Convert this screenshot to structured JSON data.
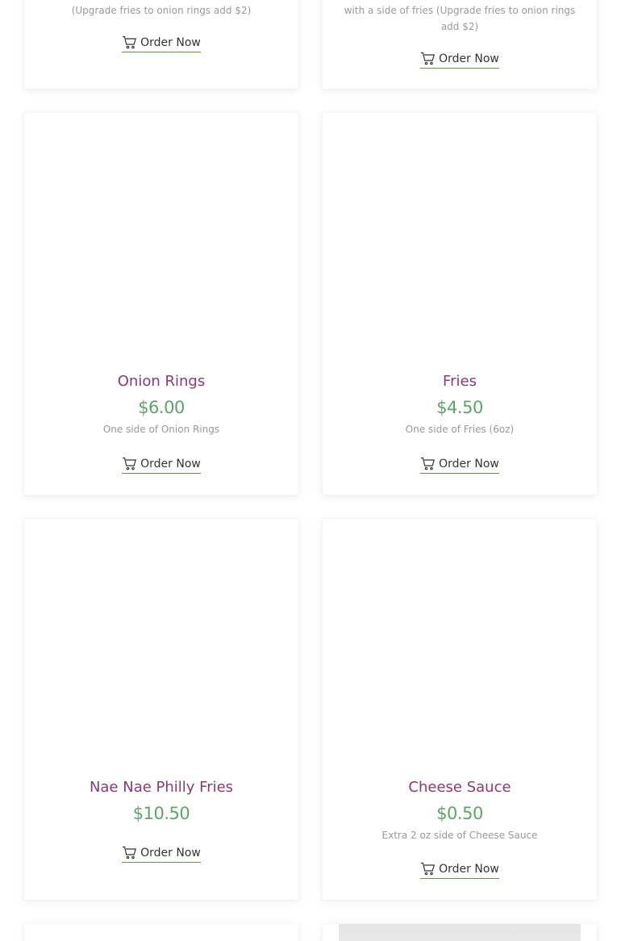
{
  "items": [
    {
      "name": "",
      "price": "",
      "description": "(Upgrade fries to onion rings add $2)",
      "order_label": "Order Now"
    },
    {
      "name": "",
      "price": "",
      "description": "with a side of fries (Upgrade fries to onion rings add $2)",
      "order_label": "Order Now"
    },
    {
      "name": "Onion Rings",
      "price": "$6.00",
      "description": "One side of Onion Rings",
      "order_label": "Order Now"
    },
    {
      "name": "Fries",
      "price": "$4.50",
      "description": "One side of Fries (6oz)",
      "order_label": "Order Now"
    },
    {
      "name": "Nae Nae Philly Fries",
      "price": "$10.50",
      "description": "",
      "order_label": "Order Now"
    },
    {
      "name": "Cheese Sauce",
      "price": "$0.50",
      "description": "Extra 2 oz side of Cheese Sauce",
      "order_label": "Order Now"
    }
  ],
  "icons": {
    "cart": "cart-icon"
  },
  "colors": {
    "name": "#8a3a78",
    "price": "#5da568",
    "description": "#9a9a9a",
    "button_underline": "#6a8f4e"
  }
}
